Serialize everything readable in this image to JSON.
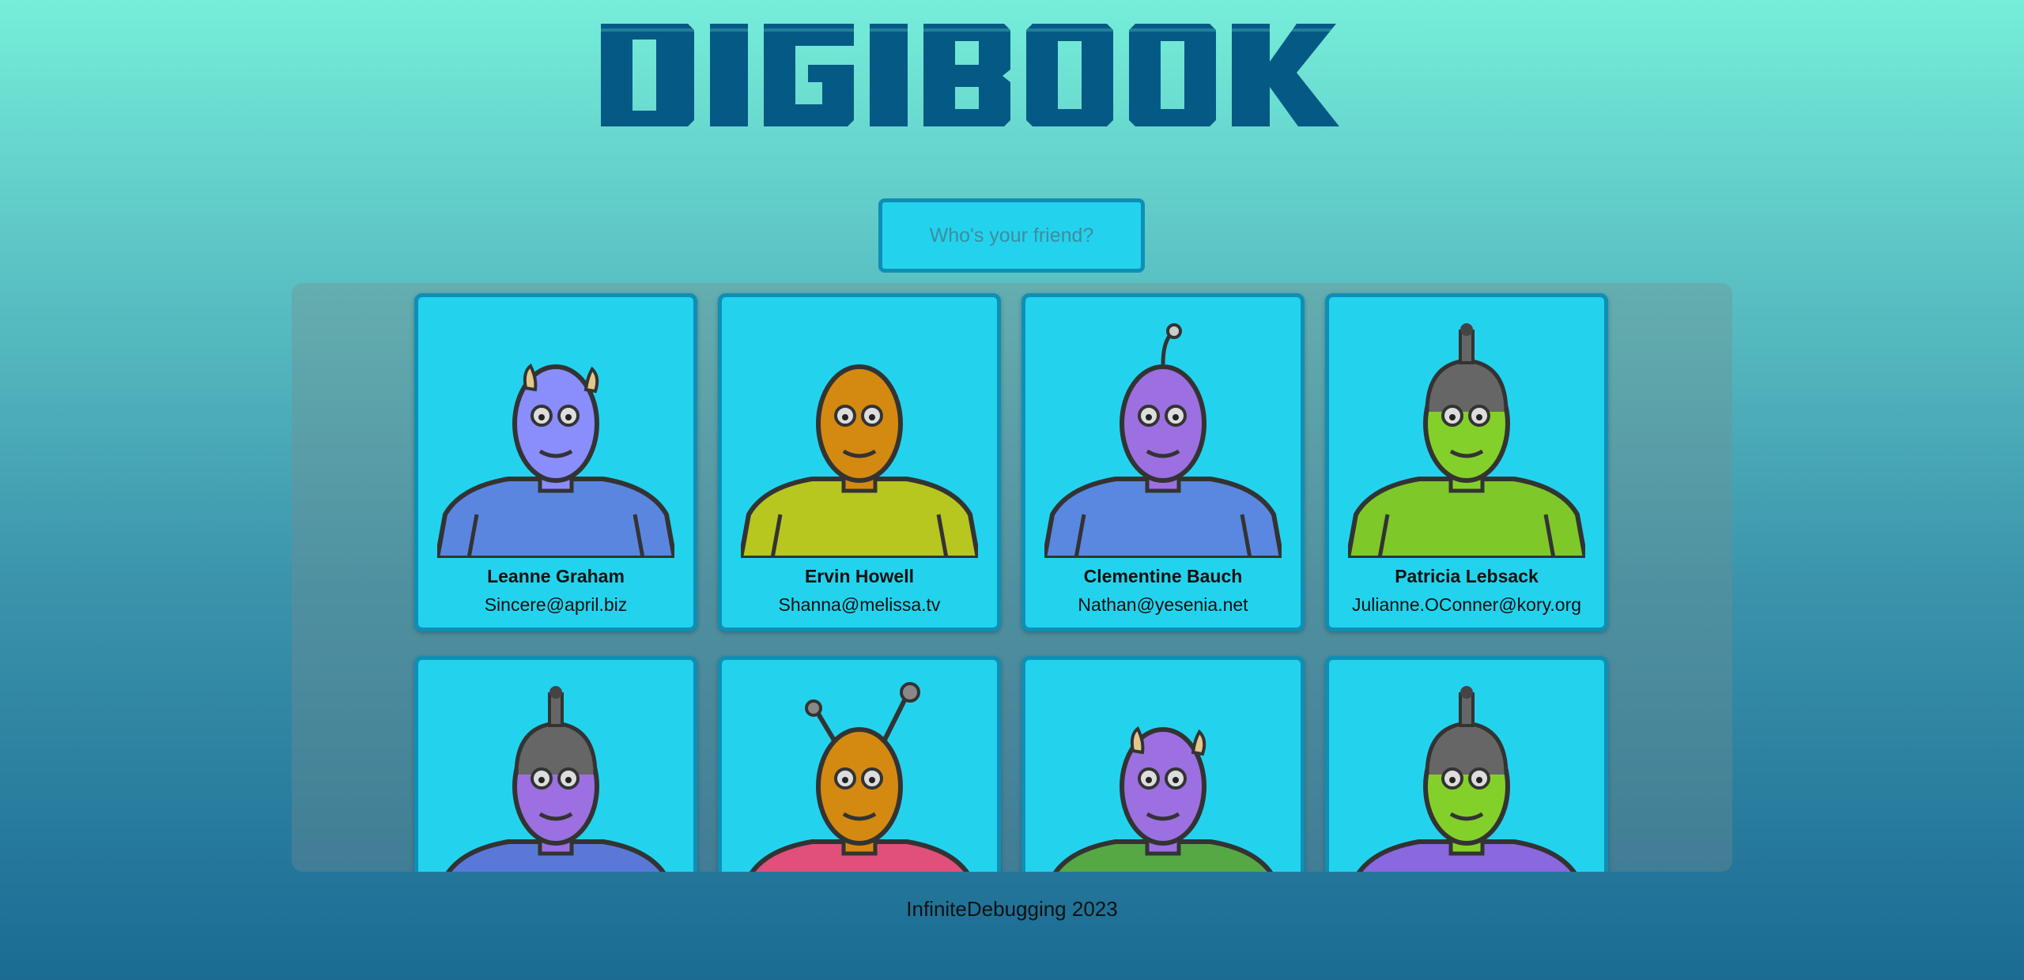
{
  "header": {
    "logo_text": "DIGIBOOK",
    "logo_color": "#055a85"
  },
  "search": {
    "placeholder": "Who's your friend?",
    "value": ""
  },
  "colors": {
    "card_bg": "#23d3ee",
    "card_border": "#0e8fb5"
  },
  "cards": [
    {
      "name": "Leanne Graham",
      "email": "Sincere@april.biz",
      "avatar_icon": "robot-avatar-icon",
      "head": "#8a8dfc",
      "body": "#5b86e0",
      "accent": "#e2c88a",
      "feature": "horns"
    },
    {
      "name": "Ervin Howell",
      "email": "Shanna@melissa.tv",
      "avatar_icon": "robot-avatar-icon",
      "head": "#d48a10",
      "body": "#b8c620",
      "accent": "#8c8a20",
      "feature": "none"
    },
    {
      "name": "Clementine Bauch",
      "email": "Nathan@yesenia.net",
      "avatar_icon": "robot-avatar-icon",
      "head": "#9c70e0",
      "body": "#5a88e0",
      "accent": "#888",
      "feature": "eyestalk"
    },
    {
      "name": "Patricia Lebsack",
      "email": "Julianne.OConner@kory.org",
      "avatar_icon": "robot-avatar-icon",
      "head": "#84d02a",
      "body": "#7ec82a",
      "accent": "#555",
      "feature": "helmet"
    },
    {
      "name": "",
      "email": "",
      "avatar_icon": "robot-avatar-icon",
      "head": "#9c70e0",
      "body": "#5a78d8",
      "accent": "#666",
      "feature": "helmet"
    },
    {
      "name": "",
      "email": "",
      "avatar_icon": "robot-avatar-icon",
      "head": "#d48a10",
      "body": "#e0507a",
      "accent": "#555",
      "feature": "antennae"
    },
    {
      "name": "",
      "email": "",
      "avatar_icon": "robot-avatar-icon",
      "head": "#9c70e0",
      "body": "#56a845",
      "accent": "#e2c88a",
      "feature": "horns"
    },
    {
      "name": "",
      "email": "",
      "avatar_icon": "robot-avatar-icon",
      "head": "#84d02a",
      "body": "#8a68e0",
      "accent": "#555",
      "feature": "helmet"
    }
  ],
  "footer": {
    "text": "InfiniteDebugging 2023"
  }
}
